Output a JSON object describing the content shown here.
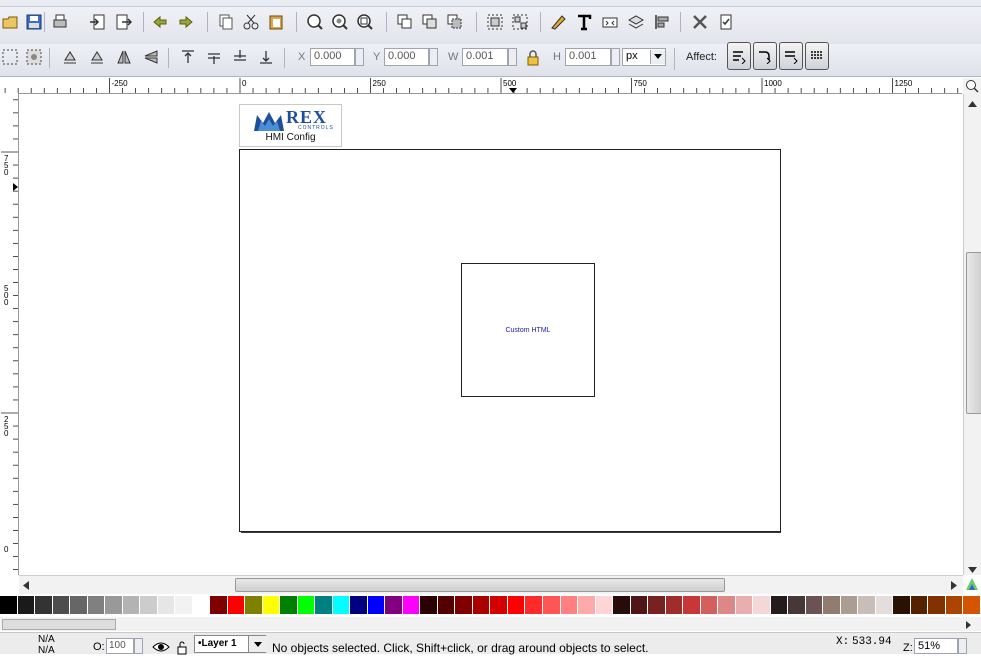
{
  "toolbar": {
    "commands": [
      "open-icon",
      "save-icon",
      "print-icon",
      "import-icon",
      "export-icon",
      "undo-icon",
      "redo-icon",
      "copy-icon",
      "cut-icon",
      "paste-icon",
      "zoom-selection-icon",
      "zoom-drawing-icon",
      "zoom-page-icon",
      "duplicate-icon",
      "clone-icon",
      "unlink-clone-icon",
      "group-icon",
      "ungroup-icon",
      "fill-stroke-icon",
      "text-font-icon",
      "xml-editor-icon",
      "layers-icon",
      "align-icon",
      "preferences-icon",
      "document-properties-icon"
    ]
  },
  "controls": {
    "x_label": "X",
    "x_value": "0.000",
    "y_label": "Y",
    "y_value": "0.000",
    "w_label": "W",
    "w_value": "0.001",
    "h_label": "H",
    "h_value": "0.001",
    "unit": "px",
    "affect_label": "Affect:"
  },
  "ruler": {
    "h_labels": [
      "-250",
      "0",
      "250",
      "500",
      "750",
      "1000",
      "1250"
    ],
    "v_labels": [
      "750",
      "500",
      "250",
      "0"
    ]
  },
  "canvas": {
    "logo_text": "REX",
    "logo_subtext": "CONTROLS",
    "logo_caption": "HMI Config",
    "element_label": "Custom HTML"
  },
  "palette": [
    "#000000",
    "#1a1a1a",
    "#333333",
    "#4d4d4d",
    "#666666",
    "#808080",
    "#999999",
    "#b3b3b3",
    "#cccccc",
    "#e6e6e6",
    "#f2f2f2",
    "#ffffff",
    "#800000",
    "#ff0000",
    "#808000",
    "#ffff00",
    "#008000",
    "#00ff00",
    "#008080",
    "#00ffff",
    "#000080",
    "#0000ff",
    "#800080",
    "#ff00ff",
    "#2b0000",
    "#550000",
    "#800000",
    "#aa0000",
    "#d40000",
    "#ff0000",
    "#ff2a2a",
    "#ff5555",
    "#ff8080",
    "#ffaaaa",
    "#ffd5d5",
    "#280b0b",
    "#501616",
    "#782121",
    "#a02c2c",
    "#c83737",
    "#d35f5f",
    "#de8787",
    "#e9afaf",
    "#f4d7d7",
    "#241c1c",
    "#483737",
    "#6c5353",
    "#917c6f",
    "#ac9d93",
    "#c8beb7",
    "#e3dedb",
    "#2b1100",
    "#552200",
    "#803300",
    "#aa4400",
    "#d45500"
  ],
  "status": {
    "fill_label": "N/A",
    "stroke_label": "N/A",
    "opacity_label": "O:",
    "opacity_value": "100",
    "layer_name": "•Layer 1",
    "message": "No objects selected. Click, Shift+click, or drag around objects to select.",
    "x_label": "X:",
    "x_coord": "533.94",
    "zoom_label": "Z:",
    "zoom_value": "51%"
  }
}
